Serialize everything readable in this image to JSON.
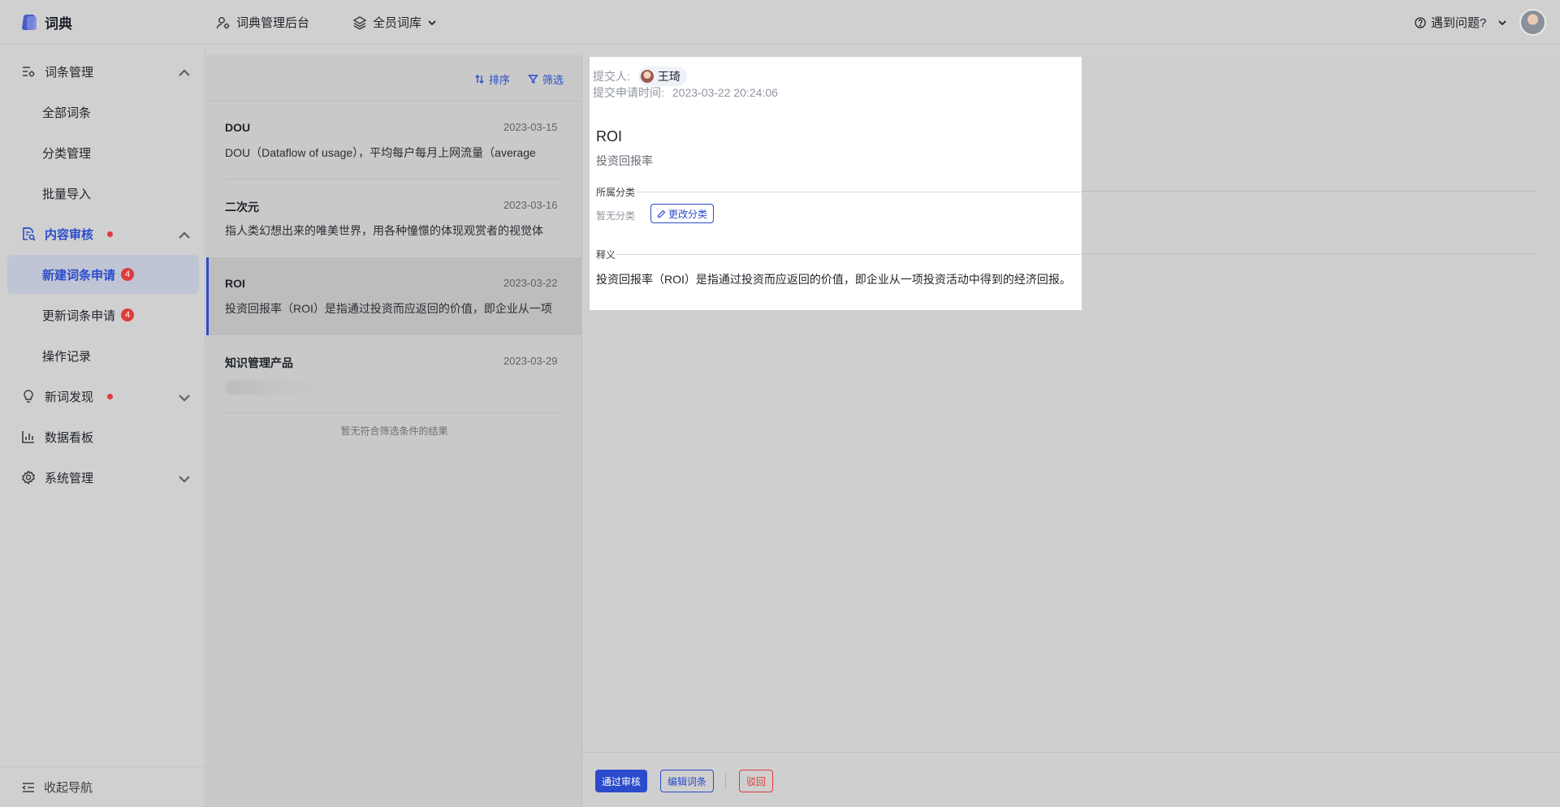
{
  "app": {
    "name": "词典"
  },
  "topnav": {
    "admin": "词典管理后台",
    "library": "全员词库",
    "help": "遇到问题?"
  },
  "sidebar": {
    "term_mgmt": "词条管理",
    "all_terms": "全部词条",
    "category_mgmt": "分类管理",
    "bulk_import": "批量导入",
    "content_review": "内容审核",
    "new_request": "新建词条申请",
    "new_request_count": "4",
    "update_request": "更新词条申请",
    "update_request_count": "4",
    "op_log": "操作记录",
    "discovery": "新词发现",
    "dashboard": "数据看板",
    "system": "系统管理",
    "collapse": "收起导航"
  },
  "list": {
    "sort_label": "排序",
    "filter_label": "筛选",
    "items": [
      {
        "title": "DOU",
        "date": "2023-03-15",
        "desc": "DOU（Dataflow of usage），平均每户每月上网流量（average"
      },
      {
        "title": "二次元",
        "date": "2023-03-16",
        "desc": "指人类幻想出来的唯美世界，用各种憧憬的体现观赏者的视觉体"
      },
      {
        "title": "ROI",
        "date": "2023-03-22",
        "desc": "投资回报率（ROI）是指通过投资而应返回的价值，即企业从一项"
      },
      {
        "title": "知识管理产品",
        "date": "2023-03-29",
        "desc": ""
      }
    ],
    "empty_note": "暂无符合筛选条件的结果"
  },
  "detail": {
    "submitter_label": "提交人:",
    "submitter_name": "王琦",
    "time_label": "提交申请时间:",
    "time_value": "2023-03-22 20:24:06",
    "term": "ROI",
    "alias": "投资回报率",
    "category_label": "所属分类",
    "no_category": "暂无分类",
    "edit_category": "更改分类",
    "definition_label": "释义",
    "definition": "投资回报率（ROI）是指通过投资而应返回的价值，即企业从一项投资活动中得到的经济回报。"
  },
  "actions": {
    "approve": "通过审核",
    "edit": "编辑词条",
    "reject": "驳回"
  },
  "colors": {
    "accent": "#2b4bcc",
    "danger": "#e03b3b"
  }
}
